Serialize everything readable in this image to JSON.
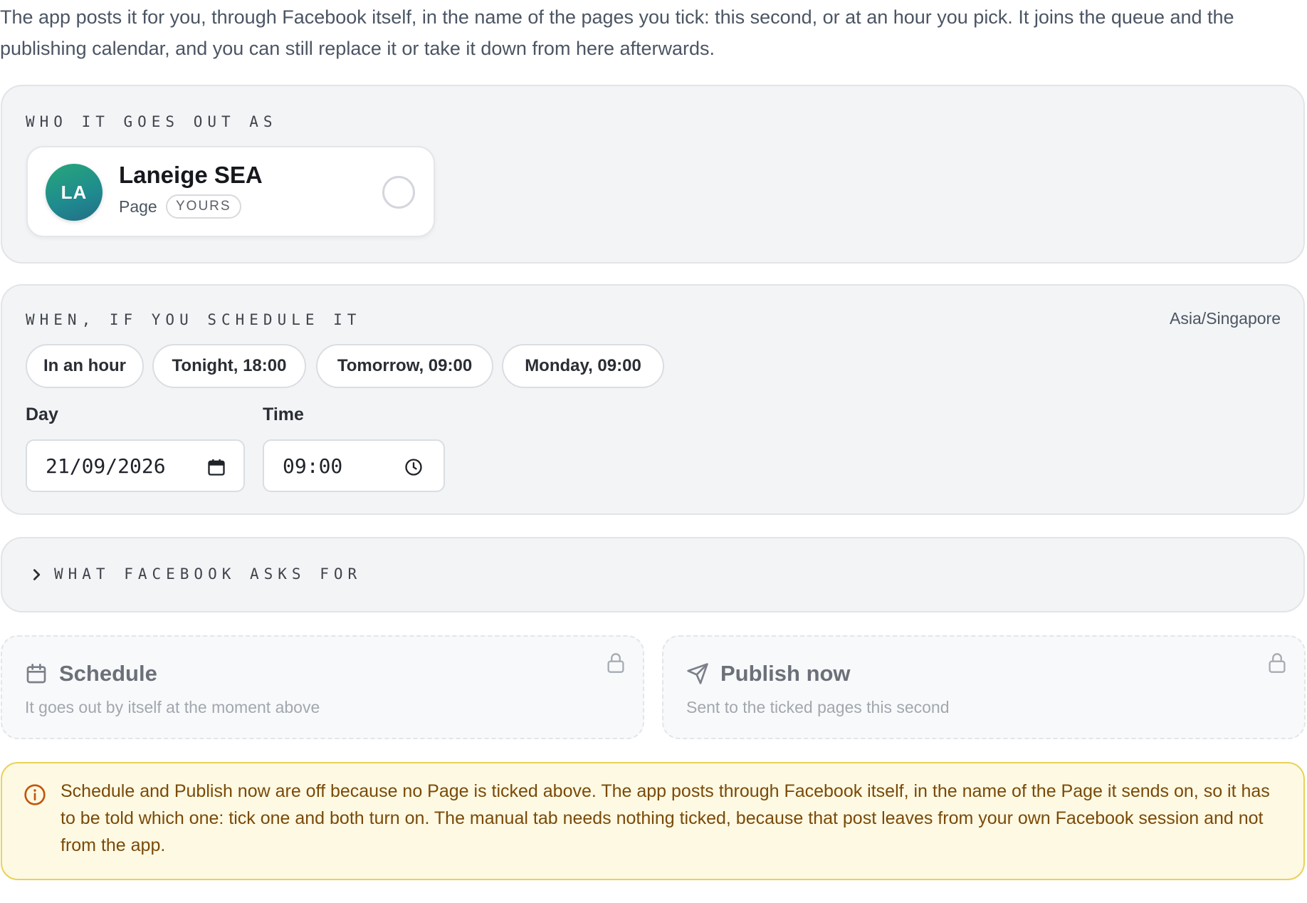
{
  "intro": {
    "text": "The app posts it for you, through Facebook itself, in the name of the pages you tick: this second, or at an hour you pick. It joins the queue and the publishing calendar, and you can still replace it or take it down from here afterwards."
  },
  "who": {
    "label": "WHO IT GOES OUT AS",
    "page": {
      "initials": "LA",
      "name": "Laneige SEA",
      "type": "Page",
      "badge": "YOURS",
      "selected": false
    }
  },
  "when": {
    "label": "WHEN, IF YOU SCHEDULE IT",
    "timezone": "Asia/Singapore",
    "presets": [
      "In an hour",
      "Tonight, 18:00",
      "Tomorrow, 09:00",
      "Monday, 09:00"
    ],
    "day_label": "Day",
    "day_value": "21/09/2026",
    "time_label": "Time",
    "time_value": "09:00"
  },
  "facebook": {
    "label": "WHAT FACEBOOK ASKS FOR",
    "expanded": false
  },
  "actions": {
    "schedule": {
      "title": "Schedule",
      "subtitle": "It goes out by itself at the moment above",
      "icon": "calendar-icon",
      "locked": true
    },
    "publish": {
      "title": "Publish now",
      "subtitle": "Sent to the ticked pages this second",
      "icon": "send-icon",
      "locked": true
    }
  },
  "notice": {
    "text": "Schedule and Publish now are off because no Page is ticked above. The app posts through Facebook itself, in the name of the Page it sends on, so it has to be told which one: tick one and both turn on. The manual tab needs nothing ticked, because that post leaves from your own Facebook session and not from the app."
  },
  "colors": {
    "avatar_gradient_start": "#26a77a",
    "avatar_gradient_end": "#236d86",
    "notice_background": "#fef9e3",
    "notice_border": "#ead25a",
    "notice_text": "#7a4a08"
  }
}
